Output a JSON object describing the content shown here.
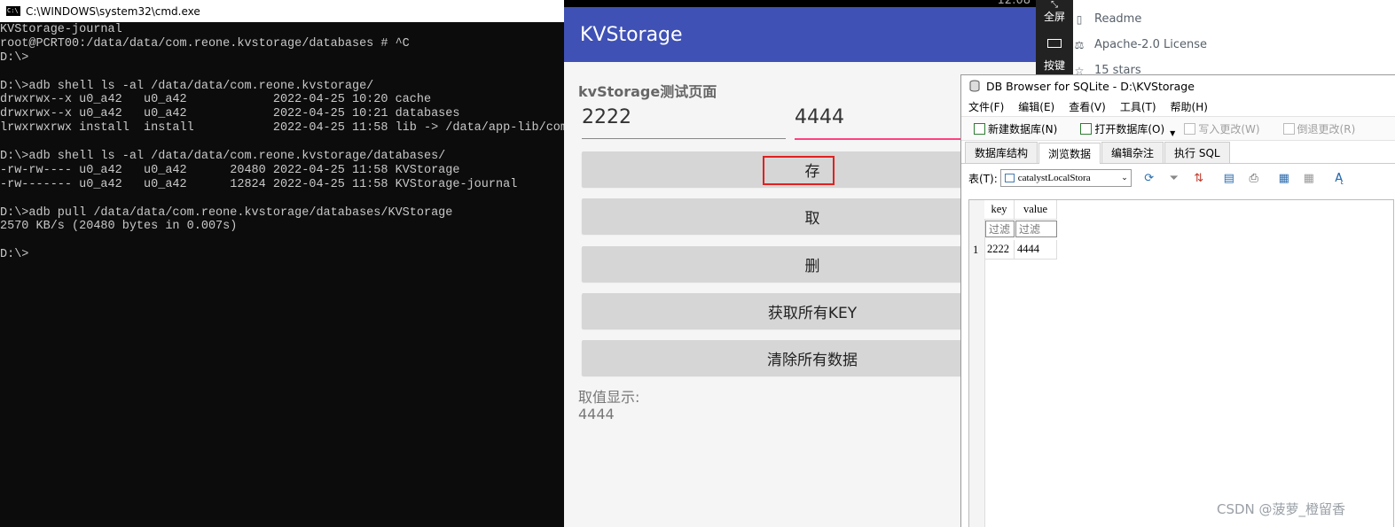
{
  "cmd": {
    "title": "C:\\WINDOWS\\system32\\cmd.exe",
    "icon_text": "C:\\",
    "lines": [
      "KVStorage-journal",
      "root@PCRT00:/data/data/com.reone.kvstorage/databases # ^C",
      "D:\\>",
      "",
      "D:\\>adb shell ls -al /data/data/com.reone.kvstorage/",
      "drwxrwx--x u0_a42   u0_a42            2022-04-25 10:20 cache",
      "drwxrwx--x u0_a42   u0_a42            2022-04-25 10:21 databases",
      "lrwxrwxrwx install  install           2022-04-25 11:58 lib -> /data/app-lib/com.",
      "",
      "D:\\>adb shell ls -al /data/data/com.reone.kvstorage/databases/",
      "-rw-rw---- u0_a42   u0_a42      20480 2022-04-25 11:58 KVStorage",
      "-rw------- u0_a42   u0_a42      12824 2022-04-25 11:58 KVStorage-journal",
      "",
      "D:\\>adb pull /data/data/com.reone.kvstorage/databases/KVStorage",
      "2570 KB/s (20480 bytes in 0.007s)",
      "",
      "D:\\>"
    ]
  },
  "android": {
    "status_time": "12:08",
    "app_title": "KVStorage",
    "page_heading": "kvStorage测试页面",
    "key_input": "2222",
    "value_input": "4444",
    "buttons": {
      "save": "存",
      "get": "取",
      "delete": "删",
      "get_all_keys": "获取所有KEY",
      "clear_all": "清除所有数据"
    },
    "result_label": "取值显示:",
    "result_value": "4444"
  },
  "emulator_toolbar": {
    "fullscreen": "全屏",
    "keys": "按键"
  },
  "github": {
    "readme": "Readme",
    "license": "Apache-2.0 License",
    "stars": "15 stars"
  },
  "dbbrowser": {
    "title": "DB Browser for SQLite - D:\\KVStorage",
    "menu": [
      "文件(F)",
      "编辑(E)",
      "查看(V)",
      "工具(T)",
      "帮助(H)"
    ],
    "toolbar": {
      "new_db": "新建数据库(N)",
      "open_db": "打开数据库(O)",
      "write_changes": "写入更改(W)",
      "revert_changes": "倒退更改(R)"
    },
    "tabs": [
      "数据库结构",
      "浏览数据",
      "编辑杂注",
      "执行 SQL"
    ],
    "table_label": "表(T):",
    "table_name": "catalystLocalStora",
    "columns": [
      "key",
      "value"
    ],
    "filter_placeholder": "过滤",
    "rows": [
      {
        "num": "1",
        "key": "2222",
        "value": "4444"
      }
    ]
  },
  "watermark": "CSDN @菠萝_橙留香"
}
